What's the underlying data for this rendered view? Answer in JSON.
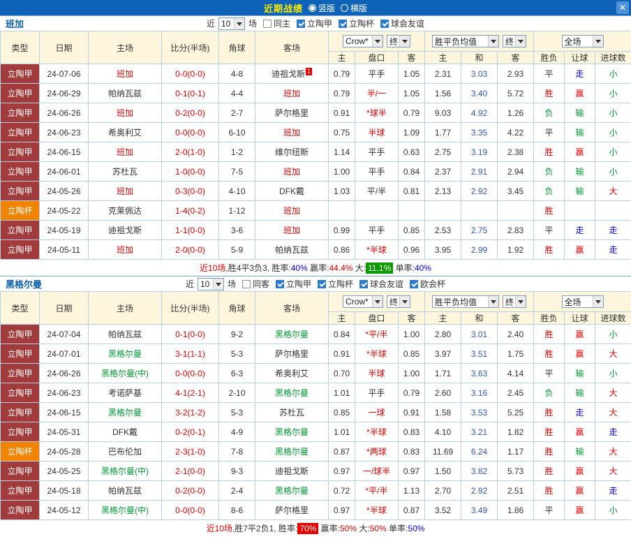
{
  "titlebar": {
    "title": "近期战绩",
    "layout_options": [
      {
        "label": "竖版",
        "selected": true
      },
      {
        "label": "横版",
        "selected": false
      }
    ],
    "close_glyph": "✕"
  },
  "colors": {
    "titlebar_bg": "#0e63b8",
    "league_default_bg": "#a23c3c",
    "league_cup_bg": "#f08300",
    "win_red": "#e60000",
    "lose_green": "#009933",
    "push_blue": "#0000ff",
    "draw_odds_blue": "#3355bb",
    "header_bg": "#fdf5dc",
    "highlight_green_bg": "#089a00",
    "highlight_red_bg": "#e60000"
  },
  "header": {
    "type": "类型",
    "date": "日期",
    "home": "主场",
    "score": "比分(半场)",
    "corner": "角球",
    "away": "客场",
    "company": "Crow*",
    "final1": "终",
    "europe": "胜平负均值",
    "final2": "终",
    "scope": "全场",
    "sub": [
      "主",
      "盘口",
      "客",
      "主",
      "和",
      "客",
      "胜负",
      "让球",
      "进球数"
    ]
  },
  "sections": [
    {
      "team": "班加",
      "filter": {
        "near": "近",
        "count": "10",
        "unit": "场",
        "checkboxes": [
          {
            "label": "同主",
            "checked": false
          },
          {
            "label": "立陶甲",
            "checked": true
          },
          {
            "label": "立陶杯",
            "checked": true
          },
          {
            "label": "球会友谊",
            "checked": true
          }
        ]
      },
      "rows": [
        {
          "league": "立陶甲",
          "league_style": "jia",
          "date": "24-07-06",
          "home": "班加",
          "home_color": "red",
          "home_badge": "",
          "score": "0-0(0-0)",
          "corner": "4-8",
          "away": "迪祖戈斯",
          "away_color": "black",
          "away_badge": "1",
          "ah_home": "0.79",
          "handicap": "平手",
          "handicap_red": false,
          "ah_away": "1.05",
          "eu_home": "2.31",
          "eu_draw": "3.03",
          "eu_away": "2.93",
          "result": "平",
          "result_color": "black",
          "asian": "走",
          "asian_color": "blue",
          "goal": "小",
          "goal_color": "green"
        },
        {
          "league": "立陶甲",
          "league_style": "jia",
          "date": "24-06-29",
          "home": "帕纳瓦兹",
          "home_color": "black",
          "home_badge": "",
          "score": "0-1(0-1)",
          "corner": "4-4",
          "away": "班加",
          "away_color": "red",
          "away_badge": "",
          "ah_home": "0.79",
          "handicap": "半/一",
          "handicap_red": true,
          "ah_away": "1.05",
          "eu_home": "1.56",
          "eu_draw": "3.40",
          "eu_away": "5.72",
          "result": "胜",
          "result_color": "red",
          "asian": "赢",
          "asian_color": "red",
          "goal": "小",
          "goal_color": "green"
        },
        {
          "league": "立陶甲",
          "league_style": "jia",
          "date": "24-06-26",
          "home": "班加",
          "home_color": "red",
          "home_badge": "",
          "score": "0-2(0-0)",
          "corner": "2-7",
          "away": "萨尔格里",
          "away_color": "black",
          "away_badge": "",
          "ah_home": "0.91",
          "handicap": "*球半",
          "handicap_red": true,
          "ah_away": "0.79",
          "eu_home": "9.03",
          "eu_draw": "4.92",
          "eu_away": "1.26",
          "result": "负",
          "result_color": "green",
          "asian": "输",
          "asian_color": "green",
          "goal": "小",
          "goal_color": "green"
        },
        {
          "league": "立陶甲",
          "league_style": "jia",
          "date": "24-06-23",
          "home": "希奥利艾",
          "home_color": "black",
          "home_badge": "",
          "score": "0-0(0-0)",
          "corner": "6-10",
          "away": "班加",
          "away_color": "red",
          "away_badge": "",
          "ah_home": "0.75",
          "handicap": "半球",
          "handicap_red": true,
          "ah_away": "1.09",
          "eu_home": "1.77",
          "eu_draw": "3.35",
          "eu_away": "4.22",
          "result": "平",
          "result_color": "black",
          "asian": "输",
          "asian_color": "green",
          "goal": "小",
          "goal_color": "green"
        },
        {
          "league": "立陶甲",
          "league_style": "jia",
          "date": "24-06-15",
          "home": "班加",
          "home_color": "red",
          "home_badge": "",
          "score": "2-0(1-0)",
          "corner": "1-2",
          "away": "维尔纽斯",
          "away_color": "black",
          "away_badge": "",
          "ah_home": "1.14",
          "handicap": "平手",
          "handicap_red": false,
          "ah_away": "0.63",
          "eu_home": "2.75",
          "eu_draw": "3.19",
          "eu_away": "2.38",
          "result": "胜",
          "result_color": "red",
          "asian": "赢",
          "asian_color": "red",
          "goal": "小",
          "goal_color": "green"
        },
        {
          "league": "立陶甲",
          "league_style": "jia",
          "date": "24-06-01",
          "home": "苏杜瓦",
          "home_color": "black",
          "home_badge": "",
          "score": "1-0(0-0)",
          "corner": "7-5",
          "away": "班加",
          "away_color": "red",
          "away_badge": "",
          "ah_home": "1.00",
          "handicap": "平手",
          "handicap_red": false,
          "ah_away": "0.84",
          "eu_home": "2.37",
          "eu_draw": "2.91",
          "eu_away": "2.94",
          "result": "负",
          "result_color": "green",
          "asian": "输",
          "asian_color": "green",
          "goal": "小",
          "goal_color": "green"
        },
        {
          "league": "立陶甲",
          "league_style": "jia",
          "date": "24-05-26",
          "home": "班加",
          "home_color": "red",
          "home_badge": "",
          "score": "0-3(0-0)",
          "corner": "4-10",
          "away": "DFK戴",
          "away_color": "black",
          "away_badge": "",
          "ah_home": "1.03",
          "handicap": "平/半",
          "handicap_red": false,
          "ah_away": "0.81",
          "eu_home": "2.13",
          "eu_draw": "2.92",
          "eu_away": "3.45",
          "result": "负",
          "result_color": "green",
          "asian": "输",
          "asian_color": "green",
          "goal": "大",
          "goal_color": "red"
        },
        {
          "league": "立陶杯",
          "league_style": "bei",
          "date": "24-05-22",
          "home": "克莱佩达",
          "home_color": "black",
          "home_badge": "",
          "score": "1-4(0-2)",
          "corner": "1-12",
          "away": "班加",
          "away_color": "red",
          "away_badge": "",
          "ah_home": "",
          "handicap": "",
          "handicap_red": false,
          "ah_away": "",
          "eu_home": "",
          "eu_draw": "",
          "eu_away": "",
          "result": "胜",
          "result_color": "red",
          "asian": "",
          "asian_color": "black",
          "goal": "",
          "goal_color": "black"
        },
        {
          "league": "立陶甲",
          "league_style": "jia",
          "date": "24-05-19",
          "home": "迪祖戈斯",
          "home_color": "black",
          "home_badge": "",
          "score": "1-1(0-0)",
          "corner": "3-6",
          "away": "班加",
          "away_color": "red",
          "away_badge": "",
          "ah_home": "0.99",
          "handicap": "平手",
          "handicap_red": false,
          "ah_away": "0.85",
          "eu_home": "2.53",
          "eu_draw": "2.75",
          "eu_away": "2.83",
          "result": "平",
          "result_color": "black",
          "asian": "走",
          "asian_color": "blue",
          "goal": "走",
          "goal_color": "blue"
        },
        {
          "league": "立陶甲",
          "league_style": "jia",
          "date": "24-05-11",
          "home": "班加",
          "home_color": "red",
          "home_badge": "",
          "score": "2-0(0-0)",
          "corner": "5-9",
          "away": "帕纳瓦兹",
          "away_color": "black",
          "away_badge": "",
          "ah_home": "0.86",
          "handicap": "*半球",
          "handicap_red": true,
          "ah_away": "0.96",
          "eu_home": "3.95",
          "eu_draw": "2.99",
          "eu_away": "1.92",
          "result": "胜",
          "result_color": "red",
          "asian": "赢",
          "asian_color": "red",
          "goal": "走",
          "goal_color": "blue"
        }
      ],
      "summary": [
        {
          "text": "近10场",
          "color": "red"
        },
        {
          "text": ",胜4平3负3, 胜率:",
          "color": "black"
        },
        {
          "text": "40%",
          "color": "blue"
        },
        {
          "text": " 赢率:",
          "color": "black"
        },
        {
          "text": "44.4%",
          "color": "red"
        },
        {
          "text": " 大:",
          "color": "black"
        },
        {
          "text": "11.1%",
          "color": "white",
          "bg": "green"
        },
        {
          "text": " 单率:",
          "color": "black"
        },
        {
          "text": "40%",
          "color": "blue"
        }
      ]
    },
    {
      "team": "黑格尔曼",
      "filter": {
        "near": "近",
        "count": "10",
        "unit": "场",
        "checkboxes": [
          {
            "label": "同客",
            "checked": false
          },
          {
            "label": "立陶甲",
            "checked": true
          },
          {
            "label": "立陶杯",
            "checked": true
          },
          {
            "label": "球会友谊",
            "checked": true
          },
          {
            "label": "欧会杯",
            "checked": true
          }
        ]
      },
      "rows": [
        {
          "league": "立陶甲",
          "league_style": "jia",
          "date": "24-07-04",
          "home": "帕纳瓦兹",
          "home_color": "black",
          "home_badge": "",
          "score": "0-1(0-0)",
          "corner": "9-2",
          "away": "黑格尔曼",
          "away_color": "green",
          "away_badge": "",
          "ah_home": "0.84",
          "handicap": "*平/半",
          "handicap_red": true,
          "ah_away": "1.00",
          "eu_home": "2.80",
          "eu_draw": "3.01",
          "eu_away": "2.40",
          "result": "胜",
          "result_color": "red",
          "asian": "赢",
          "asian_color": "red",
          "goal": "小",
          "goal_color": "green"
        },
        {
          "league": "立陶甲",
          "league_style": "jia",
          "date": "24-07-01",
          "home": "黑格尔曼",
          "home_color": "green",
          "home_badge": "",
          "score": "3-1(1-1)",
          "corner": "5-3",
          "away": "萨尔格里",
          "away_color": "black",
          "away_badge": "",
          "ah_home": "0.91",
          "handicap": "*半球",
          "handicap_red": true,
          "ah_away": "0.85",
          "eu_home": "3.97",
          "eu_draw": "3.51",
          "eu_away": "1.75",
          "result": "胜",
          "result_color": "red",
          "asian": "赢",
          "asian_color": "red",
          "goal": "大",
          "goal_color": "red"
        },
        {
          "league": "立陶甲",
          "league_style": "jia",
          "date": "24-06-26",
          "home": "黑格尔曼(中)",
          "home_color": "green",
          "home_badge": "",
          "score": "0-0(0-0)",
          "corner": "6-3",
          "away": "希奥利艾",
          "away_color": "black",
          "away_badge": "",
          "ah_home": "0.70",
          "handicap": "半球",
          "handicap_red": true,
          "ah_away": "1.00",
          "eu_home": "1.71",
          "eu_draw": "3.63",
          "eu_away": "4.14",
          "result": "平",
          "result_color": "black",
          "asian": "输",
          "asian_color": "green",
          "goal": "小",
          "goal_color": "green"
        },
        {
          "league": "立陶甲",
          "league_style": "jia",
          "date": "24-06-23",
          "home": "考诺萨基",
          "home_color": "black",
          "home_badge": "",
          "score": "4-1(2-1)",
          "corner": "2-10",
          "away": "黑格尔曼",
          "away_color": "green",
          "away_badge": "",
          "ah_home": "1.01",
          "handicap": "平手",
          "handicap_red": false,
          "ah_away": "0.79",
          "eu_home": "2.60",
          "eu_draw": "3.16",
          "eu_away": "2.45",
          "result": "负",
          "result_color": "green",
          "asian": "输",
          "asian_color": "green",
          "goal": "大",
          "goal_color": "red"
        },
        {
          "league": "立陶甲",
          "league_style": "jia",
          "date": "24-06-15",
          "home": "黑格尔曼",
          "home_color": "green",
          "home_badge": "",
          "score": "3-2(1-2)",
          "corner": "5-3",
          "away": "苏杜瓦",
          "away_color": "black",
          "away_badge": "",
          "ah_home": "0.85",
          "handicap": "一球",
          "handicap_red": true,
          "ah_away": "0.91",
          "eu_home": "1.58",
          "eu_draw": "3.53",
          "eu_away": "5.25",
          "result": "胜",
          "result_color": "red",
          "asian": "走",
          "asian_color": "blue",
          "goal": "大",
          "goal_color": "red"
        },
        {
          "league": "立陶甲",
          "league_style": "jia",
          "date": "24-05-31",
          "home": "DFK戴",
          "home_color": "black",
          "home_badge": "",
          "score": "0-2(0-1)",
          "corner": "4-9",
          "away": "黑格尔曼",
          "away_color": "green",
          "away_badge": "",
          "ah_home": "1.01",
          "handicap": "*半球",
          "handicap_red": true,
          "ah_away": "0.83",
          "eu_home": "4.10",
          "eu_draw": "3.21",
          "eu_away": "1.82",
          "result": "胜",
          "result_color": "red",
          "asian": "赢",
          "asian_color": "red",
          "goal": "走",
          "goal_color": "blue"
        },
        {
          "league": "立陶杯",
          "league_style": "bei",
          "date": "24-05-28",
          "home": "巴布伦加",
          "home_color": "black",
          "home_badge": "",
          "score": "2-3(1-0)",
          "corner": "7-8",
          "away": "黑格尔曼",
          "away_color": "green",
          "away_badge": "",
          "ah_home": "0.87",
          "handicap": "*两球",
          "handicap_red": true,
          "ah_away": "0.83",
          "eu_home": "11.69",
          "eu_draw": "6.24",
          "eu_away": "1.17",
          "result": "胜",
          "result_color": "red",
          "asian": "输",
          "asian_color": "green",
          "goal": "大",
          "goal_color": "red"
        },
        {
          "league": "立陶甲",
          "league_style": "jia",
          "date": "24-05-25",
          "home": "黑格尔曼(中)",
          "home_color": "green",
          "home_badge": "",
          "score": "2-1(0-0)",
          "corner": "9-3",
          "away": "迪祖戈斯",
          "away_color": "black",
          "away_badge": "",
          "ah_home": "0.97",
          "handicap": "一/球半",
          "handicap_red": true,
          "ah_away": "0.97",
          "eu_home": "1.50",
          "eu_draw": "3.82",
          "eu_away": "5.73",
          "result": "胜",
          "result_color": "red",
          "asian": "赢",
          "asian_color": "red",
          "goal": "大",
          "goal_color": "red"
        },
        {
          "league": "立陶甲",
          "league_style": "jia",
          "date": "24-05-18",
          "home": "帕纳瓦兹",
          "home_color": "black",
          "home_badge": "",
          "score": "0-2(0-0)",
          "corner": "2-4",
          "away": "黑格尔曼",
          "away_color": "green",
          "away_badge": "",
          "ah_home": "0.72",
          "handicap": "*平/半",
          "handicap_red": true,
          "ah_away": "1.13",
          "eu_home": "2.70",
          "eu_draw": "2.92",
          "eu_away": "2.51",
          "result": "胜",
          "result_color": "red",
          "asian": "赢",
          "asian_color": "red",
          "goal": "走",
          "goal_color": "blue"
        },
        {
          "league": "立陶甲",
          "league_style": "jia",
          "date": "24-05-12",
          "home": "黑格尔曼(中)",
          "home_color": "green",
          "home_badge": "",
          "score": "0-0(0-0)",
          "corner": "8-6",
          "away": "萨尔格里",
          "away_color": "black",
          "away_badge": "",
          "ah_home": "0.97",
          "handicap": "*半球",
          "handicap_red": true,
          "ah_away": "0.87",
          "eu_home": "3.52",
          "eu_draw": "3.49",
          "eu_away": "1.86",
          "result": "平",
          "result_color": "black",
          "asian": "赢",
          "asian_color": "red",
          "goal": "小",
          "goal_color": "green"
        }
      ],
      "summary": [
        {
          "text": "近10场",
          "color": "red"
        },
        {
          "text": ",胜7平2负1, 胜率:",
          "color": "black"
        },
        {
          "text": "70%",
          "color": "white",
          "bg": "red"
        },
        {
          "text": " 赢率:",
          "color": "black"
        },
        {
          "text": "50%",
          "color": "red"
        },
        {
          "text": " 大:",
          "color": "black"
        },
        {
          "text": "50%",
          "color": "red"
        },
        {
          "text": " 单率:",
          "color": "black"
        },
        {
          "text": "50%",
          "color": "blue"
        }
      ]
    }
  ]
}
